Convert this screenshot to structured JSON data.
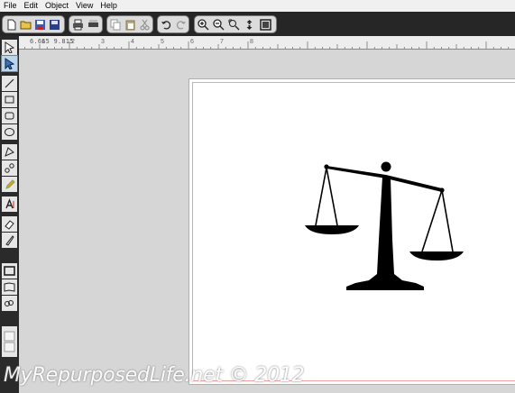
{
  "menu": {
    "items": [
      {
        "label": "File"
      },
      {
        "label": "Edit"
      },
      {
        "label": "Object"
      },
      {
        "label": "View"
      },
      {
        "label": "Help"
      }
    ]
  },
  "ruler": {
    "coords": "6.665 9.815",
    "labels": [
      "1",
      "2",
      "3",
      "4",
      "5",
      "6",
      "7",
      "8"
    ]
  },
  "toolbar": {
    "icons": [
      "new-doc-icon",
      "open-folder-icon",
      "save-icon",
      "save-as-icon",
      "print-icon",
      "print-preview-icon",
      "copy-icon",
      "paste-icon",
      "cut-icon",
      "undo-icon",
      "redo-icon",
      "zoom-in-icon",
      "zoom-out-icon",
      "zoom-selection-icon",
      "zoom-fit-icon",
      "zoom-page-icon"
    ]
  },
  "tools": [
    "select-tool",
    "node-tool",
    "line-tool",
    "rectangle-tool",
    "rounded-rect-tool",
    "ellipse-tool",
    "polygon-tool",
    "bezier-tool",
    "pencil-tool",
    "text-tool",
    "eraser-tool",
    "knife-tool",
    "view-single-tool",
    "view-mat-tool",
    "view-weld-tool",
    "layout-tool"
  ],
  "watermark": "MyRepurposedLife.net © 2012",
  "colors": {
    "accent": "#5a86b8",
    "cutline": "#f2a0a0",
    "chrome": "#262626"
  }
}
